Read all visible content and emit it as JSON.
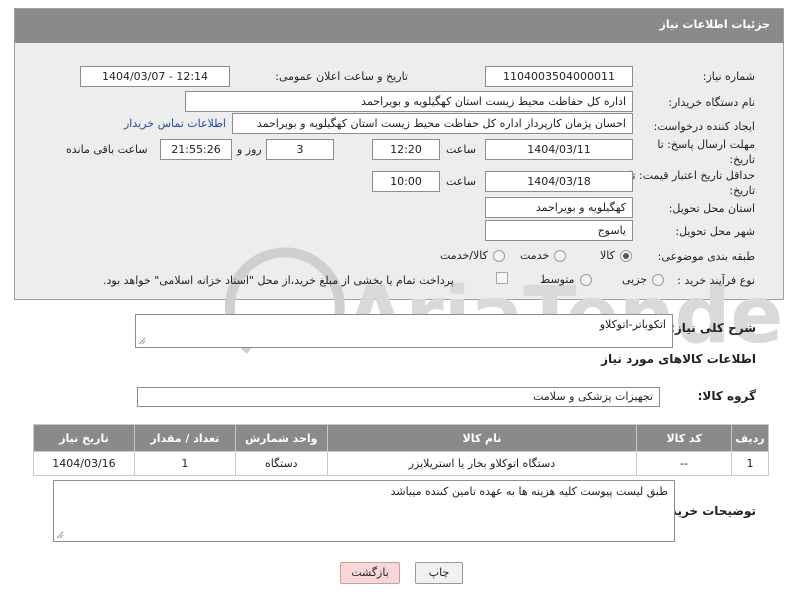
{
  "header": {
    "title": "جزئیات اطلاعات نیاز"
  },
  "watermark": {
    "text": "AriaTender.neT"
  },
  "form": {
    "need_number": {
      "label": "شماره نیاز:",
      "value": "1104003504000011"
    },
    "announce_date": {
      "label": "تاریخ و ساعت اعلان عمومی:",
      "value": "1404/03/07 - 12:14"
    },
    "buyer_org": {
      "label": "نام دستگاه خریدار:",
      "value": "اداره کل حفاظت محیط زیست استان کهگیلویه و بویراحمد"
    },
    "creator": {
      "label": "ایجاد کننده درخواست:",
      "value": "احسان پژمان کارپرداز اداره کل حفاظت محیط زیست استان کهگیلویه و بویراحمد",
      "contact_link": "اطلاعات تماس خریدار"
    },
    "reply_deadline": {
      "label": "مهلت ارسال پاسخ: تا تاریخ:",
      "date": "1404/03/11",
      "time_label": "ساعت",
      "time": "12:20",
      "days": "3",
      "days_label": "روز و",
      "remaining": "21:55:26",
      "remaining_label": "ساعت باقی مانده"
    },
    "price_validity": {
      "label": "حداقل تاریخ اعتبار قیمت: تا تاریخ:",
      "date": "1404/03/18",
      "time_label": "ساعت",
      "time": "10:00"
    },
    "delivery_province": {
      "label": "استان محل تحویل:",
      "value": "کهگیلویه و بویراحمد"
    },
    "delivery_city": {
      "label": "شهر محل تحویل:",
      "value": "یاسوج"
    },
    "category": {
      "label": "طبقه بندی موضوعی:",
      "options": [
        "کالا",
        "خدمت",
        "کالا/خدمت"
      ],
      "selected": "کالا"
    },
    "purchase_type": {
      "label": "نوع فرآیند خرید :",
      "options": [
        "جزیی",
        "متوسط"
      ],
      "selected": "",
      "payment_note": "پرداخت تمام یا بخشی از مبلغ خرید،از محل \"اسناد خزانه اسلامی\" خواهد بود."
    }
  },
  "description": {
    "label": "شرح کلی نیاز:",
    "value": "اتکوباتر-اتوکلاو"
  },
  "goods_info": {
    "title": "اطلاعات کالاهای مورد نیاز"
  },
  "goods_group": {
    "label": "گروه کالا:",
    "value": "تجهیزات پزشکی و سلامت"
  },
  "table": {
    "headers": [
      "ردیف",
      "کد کالا",
      "نام کالا",
      "واحد شمارش",
      "تعداد / مقدار",
      "تاریخ نیاز"
    ],
    "rows": [
      [
        "1",
        "--",
        "دستگاه اتوکلاو بخار یا استریلایزر",
        "دستگاه",
        "1",
        "1404/03/16"
      ]
    ]
  },
  "buyer_notes": {
    "label": "توضیحات خریدار:",
    "value": "طبق لیست پیوست کلیه هزینه ها به عهده تامین کننده میباشد"
  },
  "buttons": {
    "print": "چاپ",
    "back": "بازگشت"
  }
}
